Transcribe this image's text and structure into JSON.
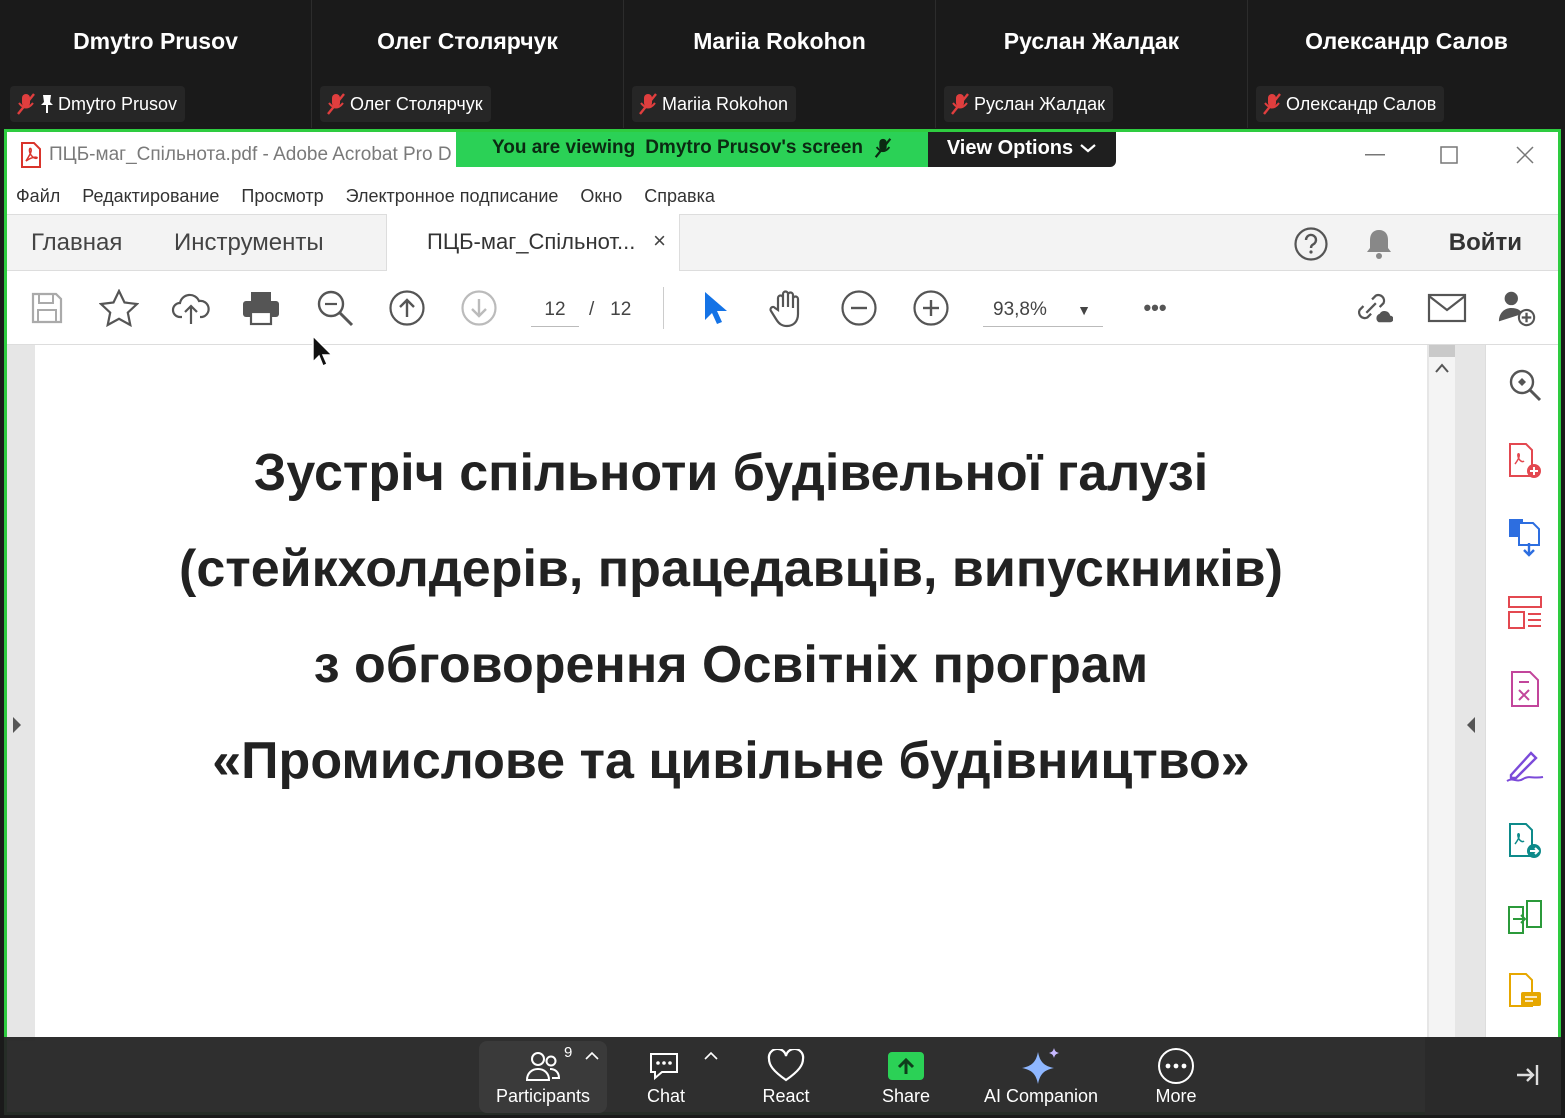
{
  "participants": [
    {
      "name": "Dmytro Prusov",
      "chip": "Dmytro Prusov",
      "pinned": true
    },
    {
      "name": "Олег Столярчук",
      "chip": "Олег Столярчук",
      "pinned": false
    },
    {
      "name": "Mariia Rokohon",
      "chip": "Mariia Rokohon",
      "pinned": false
    },
    {
      "name": "Руслан Жалдак",
      "chip": "Руслан Жалдак",
      "pinned": false
    },
    {
      "name": "Олександр Салов",
      "chip": "Олександр Салов",
      "pinned": false
    }
  ],
  "share_banner": {
    "prefix": "You are viewing",
    "owner": "Dmytro Prusov's screen",
    "view_options": "View Options"
  },
  "window": {
    "title": "ПЦБ-маг_Спільнота.pdf - Adobe Acrobat Pro D"
  },
  "menu": [
    "Файл",
    "Редактирование",
    "Просмотр",
    "Электронное подписание",
    "Окно",
    "Справка"
  ],
  "tabs": {
    "home": "Главная",
    "tools": "Инструменты",
    "document": "ПЦБ-маг_Спільнот...",
    "close": "×",
    "sign_in": "Войти"
  },
  "toolbar": {
    "current_page": "12",
    "page_separator": "/",
    "total_pages": "12",
    "zoom": "93,8%",
    "more": "•••"
  },
  "document": {
    "lines": [
      "Зустріч спільноти будівельної галузі",
      "(стейкхолдерів, працедавців, випускників)",
      "з обговорення Освітніх програм",
      "«Промислове та цивільне будівництво»"
    ]
  },
  "zoom_controls": {
    "participants_label": "Participants",
    "participants_count": "9",
    "chat": "Chat",
    "react": "React",
    "share": "Share",
    "ai": "AI Companion",
    "more": "More"
  },
  "colors": {
    "share_green": "#2bd156",
    "border_green": "#2ecc40",
    "acrobat_red": "#d9342b",
    "select_blue": "#1473e6"
  }
}
